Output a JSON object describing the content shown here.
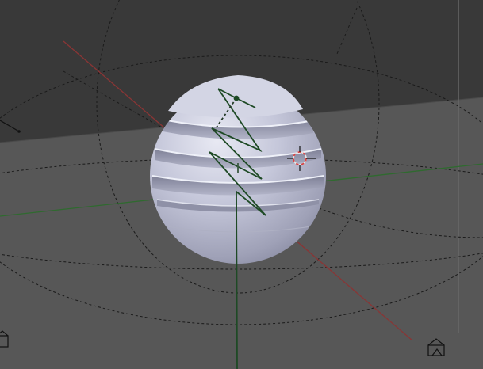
{
  "app": {
    "name": ""
  },
  "viewport": {
    "mode": "3d-viewport",
    "background_color": "#3d3d3d",
    "floor_color": "#585858",
    "ceiling_color": "#383838"
  },
  "objects": [
    {
      "type": "sphere",
      "label": "",
      "color": "#c5c7da"
    },
    {
      "type": "armature",
      "label": "",
      "color": "#1e4a25"
    }
  ],
  "gizmos": {
    "x_axis_color": "#8a3535",
    "y_axis_color": "#2f6a2f",
    "z_axis_color": "#1f5a22",
    "cursor_color": "#d84545"
  },
  "icons": [
    "camera-icon",
    "light-icon",
    "3d-cursor-icon"
  ]
}
